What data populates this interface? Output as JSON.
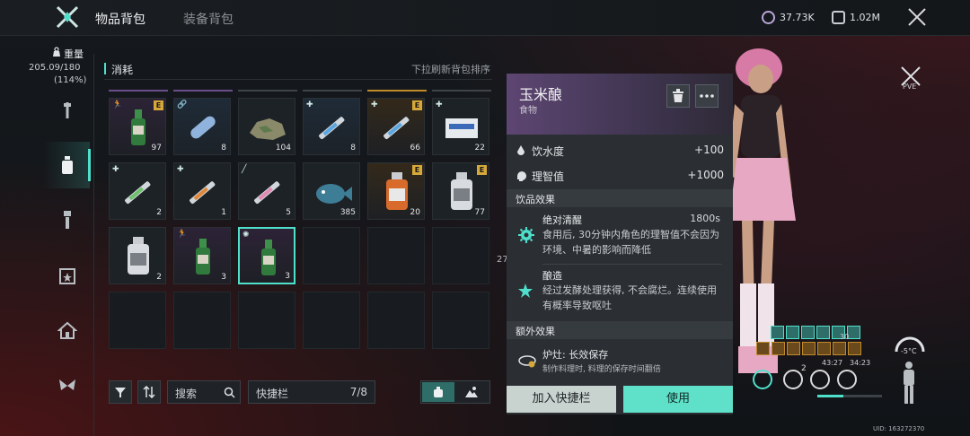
{
  "header": {
    "tabs": [
      {
        "label": "物品背包",
        "active": true
      },
      {
        "label": "装备背包",
        "active": false
      }
    ],
    "currency_a": "37.73K",
    "currency_b": "1.02M"
  },
  "sidebar": {
    "weight_label": "重量",
    "weight_value": "205.09/180",
    "weight_percent": "(114%)",
    "items": [
      {
        "icon": "wrench-icon"
      },
      {
        "icon": "bottle-icon",
        "active": true
      },
      {
        "icon": "flashlight-icon"
      },
      {
        "icon": "calendar-icon"
      },
      {
        "icon": "home-icon"
      },
      {
        "icon": "butterfly-icon"
      }
    ]
  },
  "inventory": {
    "section_title": "消耗",
    "sort_hint": "下拉刷新背包排序",
    "slots": [
      {
        "count": "97",
        "rarity": "purple",
        "badge": "E",
        "tl": "run",
        "art": "bottle"
      },
      {
        "count": "8",
        "rarity": "blue",
        "badge": "",
        "tl": "link",
        "art": "pill"
      },
      {
        "count": "104",
        "rarity": "grey",
        "badge": "",
        "tl": "",
        "art": "rock"
      },
      {
        "count": "8",
        "rarity": "blue",
        "badge": "",
        "tl": "plus",
        "art": "syringe"
      },
      {
        "count": "66",
        "rarity": "gold",
        "badge": "E",
        "tl": "plus",
        "art": "syringe"
      },
      {
        "count": "22",
        "rarity": "grey",
        "badge": "",
        "tl": "plus",
        "art": "kit"
      },
      {
        "count": "2",
        "rarity": "grey",
        "badge": "",
        "tl": "plus",
        "art": "syringe-g"
      },
      {
        "count": "1",
        "rarity": "grey",
        "badge": "",
        "tl": "plus",
        "art": "syringe-o"
      },
      {
        "count": "5",
        "rarity": "grey",
        "badge": "",
        "tl": "slash",
        "art": "syringe-p"
      },
      {
        "count": "385",
        "rarity": "grey",
        "badge": "",
        "tl": "",
        "art": "fish"
      },
      {
        "count": "20",
        "rarity": "gold",
        "badge": "E",
        "tl": "",
        "art": "jar-o"
      },
      {
        "count": "77",
        "rarity": "grey",
        "badge": "E",
        "tl": "",
        "art": "jar-w"
      },
      {
        "count": "2",
        "rarity": "grey",
        "badge": "",
        "tl": "",
        "art": "jar-w"
      },
      {
        "count": "3",
        "rarity": "purple",
        "badge": "",
        "tl": "run",
        "art": "bottle"
      },
      {
        "count": "3",
        "rarity": "purple",
        "badge": "",
        "tl": "gear",
        "art": "bottle",
        "selected": true
      }
    ],
    "search_placeholder": "搜索",
    "quickbar_label": "快捷栏",
    "quickbar_count": "7/8"
  },
  "detail": {
    "title": "玉米酿",
    "category": "食物",
    "stats": [
      {
        "label": "饮水度",
        "value": "+100",
        "icon": "drop-icon"
      },
      {
        "label": "理智值",
        "value": "+1000",
        "icon": "head-icon"
      }
    ],
    "drink_effects_title": "饮品效果",
    "effects": [
      {
        "name": "绝对清醒",
        "duration": "1800s",
        "desc": "食用后, 30分钟内角色的理智值不会因为环境、中暑的影响而降低",
        "icon": "gear-icon"
      },
      {
        "name": "酿造",
        "duration": "",
        "desc": "经过发酵处理获得, 不会腐烂。连续使用有概率导致呕吐",
        "icon": "star-icon"
      }
    ],
    "extra_title": "额外效果",
    "extra_name": "炉灶: 长效保存",
    "extra_desc": "制作料理时, 料理的保存时间翻倍",
    "btn_quickbar": "加入快捷栏",
    "btn_use": "使用"
  },
  "hud": {
    "pve_label": "PVE",
    "temperature": "-5°C",
    "uid": "UID: 163272370",
    "buff_num": "30",
    "timer_a": "43:27",
    "timer_b": "34:23",
    "status_num": "2",
    "hp_percent": 40,
    "behind_panel_text": "27"
  },
  "colors": {
    "accent": "#4fe0cc",
    "purple_rarity": "#6a4d8a",
    "gold_rarity": "#d6a83a",
    "use_button": "#5fe0c8"
  }
}
